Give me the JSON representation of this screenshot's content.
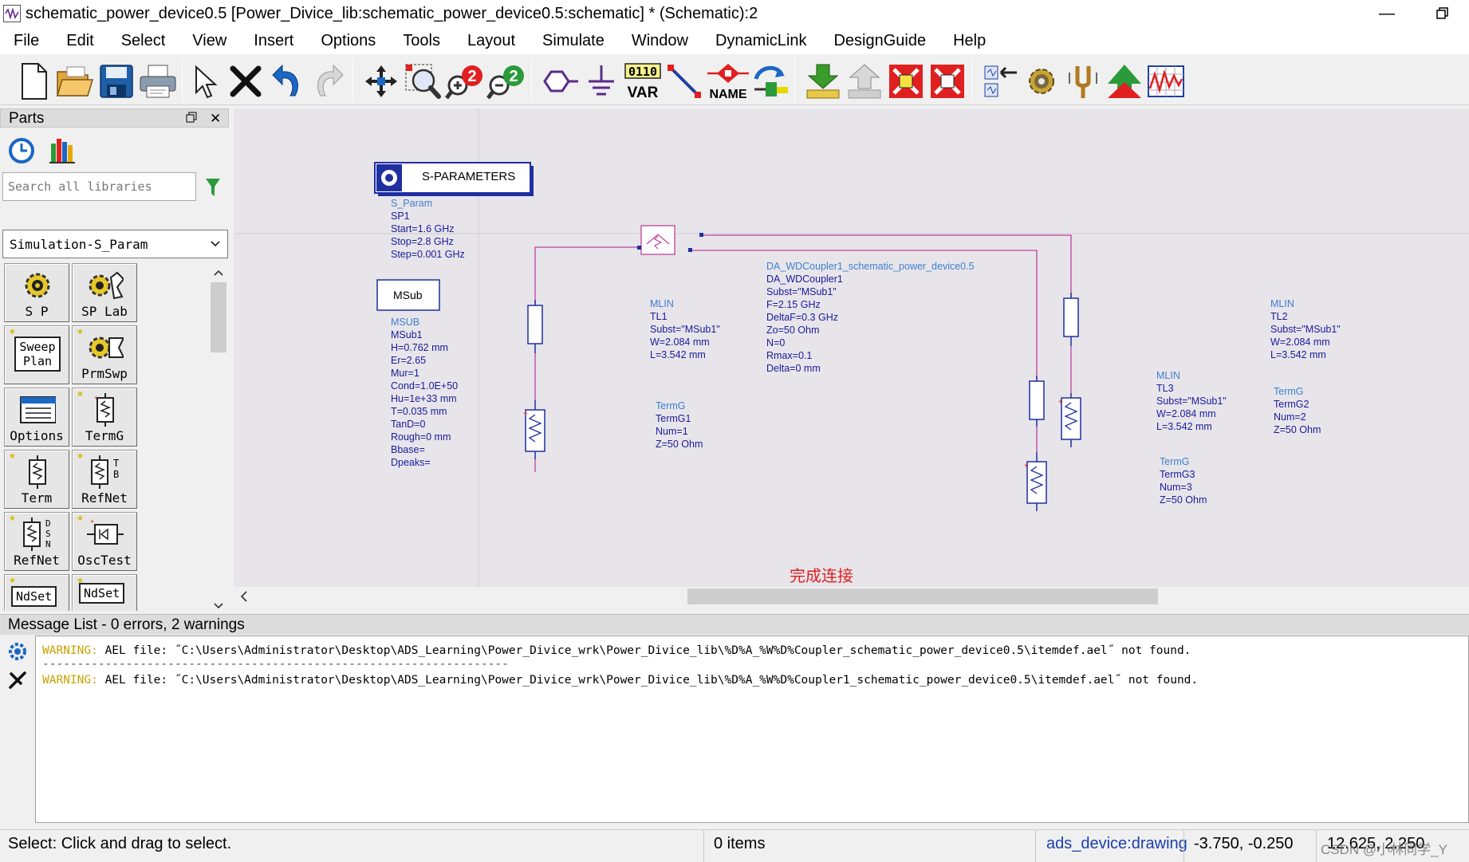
{
  "window": {
    "title": "schematic_power_device0.5 [Power_Divice_lib:schematic_power_device0.5:schematic] * (Schematic):2",
    "minimize": "—",
    "restore": "❐",
    "app_icon": "ads-schematic-icon"
  },
  "menu": [
    "File",
    "Edit",
    "Select",
    "View",
    "Insert",
    "Options",
    "Tools",
    "Layout",
    "Simulate",
    "Window",
    "DynamicLink",
    "DesignGuide",
    "Help"
  ],
  "toolbar": {
    "icons": [
      "new-icon",
      "open-icon",
      "save-icon",
      "print-icon",
      "select-arrow-icon",
      "delete-icon",
      "undo-icon",
      "redo-icon",
      "pan-icon",
      "zoom-area-icon",
      "zoom-in-icon",
      "zoom-out-icon",
      "port-icon",
      "ground-icon",
      "var-icon",
      "wire-icon",
      "name-icon",
      "simulate-icon",
      "push-into-icon",
      "pop-out-icon",
      "deactivate-icon",
      "short-icon",
      "tune-icon",
      "gear-icon",
      "tuning-fork-icon",
      "optimize-icon",
      "display-icon"
    ],
    "var_label": "VAR",
    "var_bits": "0110",
    "name_label": "NAME"
  },
  "parts": {
    "title": "Parts",
    "search_placeholder": "Search all libraries",
    "library": "Simulation-S_Param",
    "palette": [
      {
        "label": "S P",
        "icon": "sp-gear-icon"
      },
      {
        "label": "SP Lab",
        "icon": "sp-lab-icon"
      },
      {
        "label": "Sweep Plan",
        "icon": "sweep-plan-icon"
      },
      {
        "label": "PrmSwp",
        "icon": "param-sweep-icon"
      },
      {
        "label": "Options",
        "icon": "options-icon"
      },
      {
        "label": "TermG",
        "icon": "termg-icon"
      },
      {
        "label": "Term",
        "icon": "term-icon"
      },
      {
        "label": "RefNet",
        "icon": "refnet-tb-icon"
      },
      {
        "label": "RefNet",
        "icon": "refnet-dsn-icon"
      },
      {
        "label": "OscTest",
        "icon": "osctest-icon"
      },
      {
        "label": "NdSet",
        "icon": "ndset-icon"
      },
      {
        "label": "NdSet",
        "icon": "ndset-name-icon"
      }
    ],
    "sweep_word1": "Sweep",
    "sweep_word2": "Plan",
    "ndset_text": "NdSet",
    "tb_text": "T\nB",
    "dsn_text": "D\nS\nN"
  },
  "schematic": {
    "sparam_box": "S-PARAMETERS",
    "sparam_text": "S_Param\nSP1\nStart=1.6 GHz\nStop=2.8 GHz\nStep=0.001 GHz",
    "msub_box": "MSub",
    "msub_text": "MSUB\nMSub1\nH=0.762 mm\nEr=2.65\nMur=1\nCond=1.0E+50\nHu=1e+33 mm\nT=0.035 mm\nTanD=0\nRough=0 mm\nBbase=\nDpeaks=",
    "coupler_text": "DA_WDCoupler1_schematic_power_device0.5\nDA_WDCoupler1\nSubst=\"MSub1\"\nF=2.15 GHz\nDeltaF=0.3 GHz\nZo=50 Ohm\nN=0\nRmax=0.1\nDelta=0 mm",
    "tl1_text": "MLIN\nTL1\nSubst=\"MSub1\"\nW=2.084 mm\nL=3.542 mm",
    "tl2_text": "MLIN\nTL2\nSubst=\"MSub1\"\nW=2.084 mm\nL=3.542 mm",
    "tl3_text": "MLIN\nTL3\nSubst=\"MSub1\"\nW=2.084 mm\nL=3.542 mm",
    "term1_text": "TermG\nTermG1\nNum=1\nZ=50 Ohm",
    "term2_text": "TermG\nTermG2\nNum=2\nZ=50 Ohm",
    "term3_text": "TermG\nTermG3\nNum=3\nZ=50 Ohm",
    "annotation": "完成连接",
    "wire_color": "#c0409a",
    "annotation_color": "#e02020"
  },
  "messages": {
    "title": "Message List - 0 errors, 2 warnings",
    "lines": [
      {
        "tag": "WARNING:",
        "text": " AEL file: ˝C:\\Users\\Administrator\\Desktop\\ADS_Learning\\Power_Divice_wrk\\Power_Divice_lib\\%D%A_%W%D%Coupler_schematic_power_device0.5\\itemdef.ael˝ not found."
      },
      {
        "tag": "WARNING:",
        "text": " AEL file: ˝C:\\Users\\Administrator\\Desktop\\ADS_Learning\\Power_Divice_wrk\\Power_Divice_lib\\%D%A_%W%D%Coupler1_schematic_power_device0.5\\itemdef.ael˝ not found."
      }
    ],
    "separator": "-------------------------------------------------------------------"
  },
  "status": {
    "hint": "Select: Click and drag to select.",
    "items": "0 items",
    "layer": "ads_device:drawing",
    "coords": "-3.750, -0.250",
    "coords2": "12.625, 2.250",
    "watermark": "CSDN @小林同学_Y"
  }
}
